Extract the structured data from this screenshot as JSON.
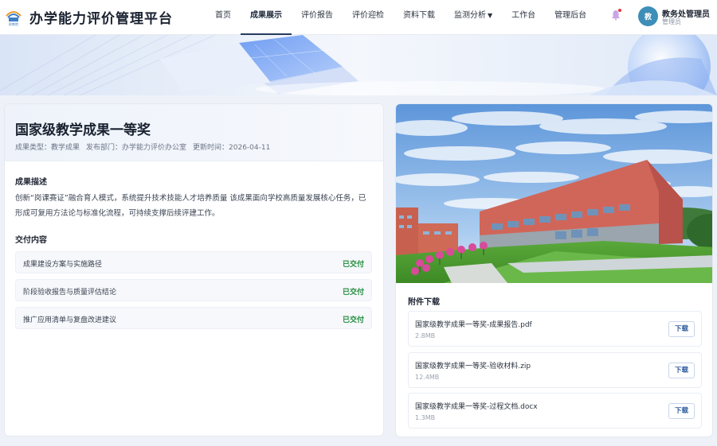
{
  "header": {
    "title": "办学能力评价管理平台",
    "logo_text": "职教院",
    "nav": [
      {
        "label": "首页",
        "active": false
      },
      {
        "label": "成果展示",
        "active": true
      },
      {
        "label": "评价报告",
        "active": false
      },
      {
        "label": "评价迎检",
        "active": false
      },
      {
        "label": "资料下载",
        "active": false
      },
      {
        "label": "监测分析",
        "active": false,
        "caret": "▼"
      },
      {
        "label": "工作台",
        "active": false
      },
      {
        "label": "管理后台",
        "active": false
      }
    ],
    "user": {
      "avatar_text": "教",
      "name": "教务处管理员",
      "role": "管理员"
    }
  },
  "detail": {
    "title": "国家级教学成果一等奖",
    "meta": {
      "type": "成果类型：教学成果",
      "dept": "发布部门：办学能力评价办公室",
      "updated": "更新时间：2026-04-11"
    },
    "desc_title": "成果描述",
    "desc": "创新“岗课赛证”融合育人模式，系统提升技术技能人才培养质量 该成果面向学校高质量发展核心任务，已形成可复用方法论与标准化流程，可持续支撑后续评建工作。",
    "deliverables_title": "交付内容",
    "deliverables": [
      {
        "label": "成果建设方案与实施路径",
        "status": "已交付"
      },
      {
        "label": "阶段验收报告与质量评估结论",
        "status": "已交付"
      },
      {
        "label": "推广应用清单与复盘改进建议",
        "status": "已交付"
      }
    ]
  },
  "attachments": {
    "title": "附件下载",
    "download_label": "下载",
    "items": [
      {
        "name": "国家级教学成果一等奖-成果报告.pdf",
        "size": "2.8MB"
      },
      {
        "name": "国家级教学成果一等奖-验收材料.zip",
        "size": "12.4MB"
      },
      {
        "name": "国家级教学成果一等奖-过程文档.docx",
        "size": "1.3MB"
      }
    ]
  },
  "colors": {
    "accent": "#253a5c",
    "success": "#1f8a3b",
    "avatar": "#3d8eb8",
    "notify": "#e5353e"
  }
}
